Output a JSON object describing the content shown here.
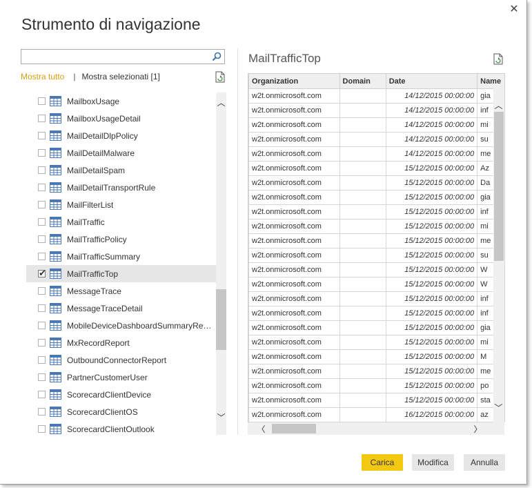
{
  "dialog": {
    "title": "Strumento di navigazione",
    "close_glyph": "✕"
  },
  "search": {
    "placeholder": "",
    "value": ""
  },
  "filters": {
    "show_all": "Mostra tutto",
    "separator": "|",
    "show_selected": "Mostra selezionati [1]"
  },
  "tree": {
    "items": [
      {
        "label": "MailboxUsage",
        "checked": false
      },
      {
        "label": "MailboxUsageDetail",
        "checked": false
      },
      {
        "label": "MailDetailDlpPolicy",
        "checked": false
      },
      {
        "label": "MailDetailMalware",
        "checked": false
      },
      {
        "label": "MailDetailSpam",
        "checked": false
      },
      {
        "label": "MailDetailTransportRule",
        "checked": false
      },
      {
        "label": "MailFilterList",
        "checked": false
      },
      {
        "label": "MailTraffic",
        "checked": false
      },
      {
        "label": "MailTrafficPolicy",
        "checked": false
      },
      {
        "label": "MailTrafficSummary",
        "checked": false
      },
      {
        "label": "MailTrafficTop",
        "checked": true
      },
      {
        "label": "MessageTrace",
        "checked": false
      },
      {
        "label": "MessageTraceDetail",
        "checked": false
      },
      {
        "label": "MobileDeviceDashboardSummaryRep...",
        "checked": false
      },
      {
        "label": "MxRecordReport",
        "checked": false
      },
      {
        "label": "OutboundConnectorReport",
        "checked": false
      },
      {
        "label": "PartnerCustomerUser",
        "checked": false
      },
      {
        "label": "ScorecardClientDevice",
        "checked": false
      },
      {
        "label": "ScorecardClientOS",
        "checked": false
      },
      {
        "label": "ScorecardClientOutlook",
        "checked": false
      }
    ]
  },
  "preview": {
    "title": "MailTrafficTop",
    "columns": [
      "Organization",
      "Domain",
      "Date",
      "Name"
    ],
    "rows": [
      [
        "w2t.onmicrosoft.com",
        "",
        "14/12/2015 00:00:00",
        "gia"
      ],
      [
        "w2t.onmicrosoft.com",
        "",
        "14/12/2015 00:00:00",
        "inf"
      ],
      [
        "w2t.onmicrosoft.com",
        "",
        "14/12/2015 00:00:00",
        "mi"
      ],
      [
        "w2t.onmicrosoft.com",
        "",
        "14/12/2015 00:00:00",
        "su"
      ],
      [
        "w2t.onmicrosoft.com",
        "",
        "14/12/2015 00:00:00",
        "me"
      ],
      [
        "w2t.onmicrosoft.com",
        "",
        "15/12/2015 00:00:00",
        "Az"
      ],
      [
        "w2t.onmicrosoft.com",
        "",
        "15/12/2015 00:00:00",
        "Da"
      ],
      [
        "w2t.onmicrosoft.com",
        "",
        "15/12/2015 00:00:00",
        "gia"
      ],
      [
        "w2t.onmicrosoft.com",
        "",
        "15/12/2015 00:00:00",
        "inf"
      ],
      [
        "w2t.onmicrosoft.com",
        "",
        "15/12/2015 00:00:00",
        "mi"
      ],
      [
        "w2t.onmicrosoft.com",
        "",
        "15/12/2015 00:00:00",
        "me"
      ],
      [
        "w2t.onmicrosoft.com",
        "",
        "15/12/2015 00:00:00",
        "su"
      ],
      [
        "w2t.onmicrosoft.com",
        "",
        "15/12/2015 00:00:00",
        "W"
      ],
      [
        "w2t.onmicrosoft.com",
        "",
        "15/12/2015 00:00:00",
        "W"
      ],
      [
        "w2t.onmicrosoft.com",
        "",
        "15/12/2015 00:00:00",
        "inf"
      ],
      [
        "w2t.onmicrosoft.com",
        "",
        "15/12/2015 00:00:00",
        "inf"
      ],
      [
        "w2t.onmicrosoft.com",
        "",
        "15/12/2015 00:00:00",
        "gia"
      ],
      [
        "w2t.onmicrosoft.com",
        "",
        "15/12/2015 00:00:00",
        "mi"
      ],
      [
        "w2t.onmicrosoft.com",
        "",
        "15/12/2015 00:00:00",
        "M"
      ],
      [
        "w2t.onmicrosoft.com",
        "",
        "15/12/2015 00:00:00",
        "me"
      ],
      [
        "w2t.onmicrosoft.com",
        "",
        "15/12/2015 00:00:00",
        "po"
      ],
      [
        "w2t.onmicrosoft.com",
        "",
        "15/12/2015 00:00:00",
        "sta"
      ],
      [
        "w2t.onmicrosoft.com",
        "",
        "16/12/2015 00:00:00",
        "az"
      ]
    ]
  },
  "buttons": {
    "load": "Carica",
    "edit": "Modifica",
    "cancel": "Annulla"
  },
  "colors": {
    "accent": "#f2c811",
    "link": "#d4a017"
  }
}
